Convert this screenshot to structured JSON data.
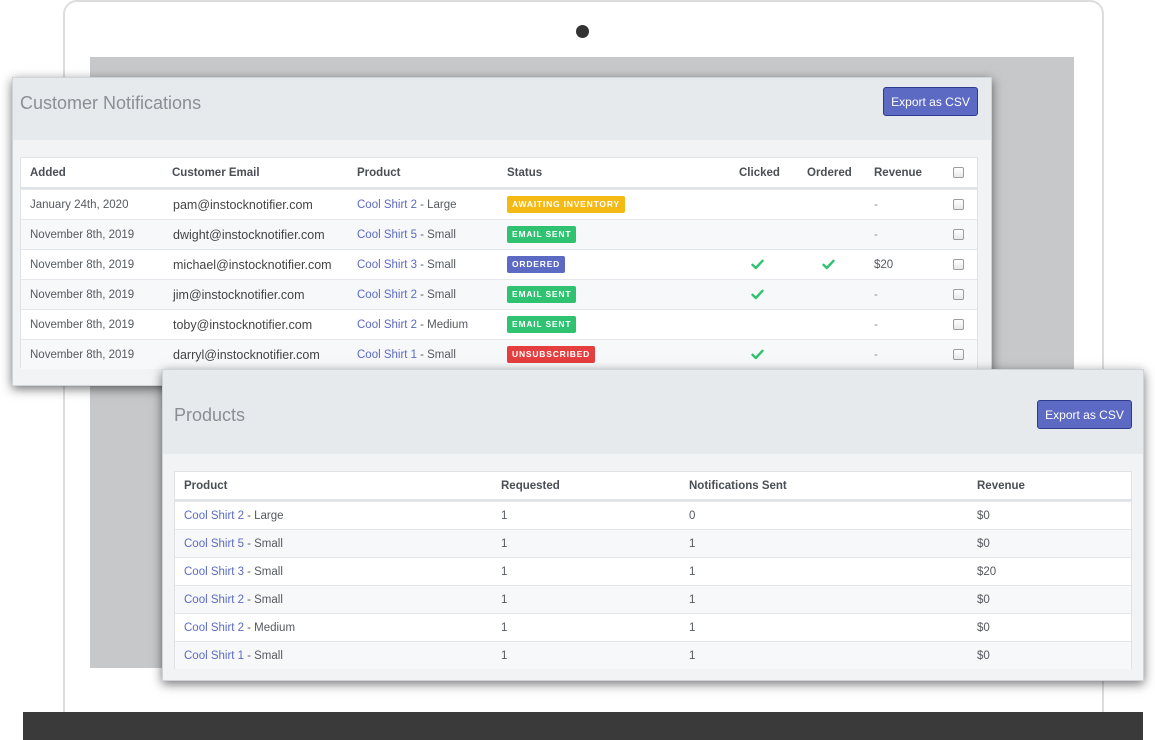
{
  "notifications": {
    "title": "Customer Notifications",
    "export_label": "Export as CSV",
    "columns": [
      "Added",
      "Customer Email",
      "Product",
      "Status",
      "Clicked",
      "Ordered",
      "Revenue"
    ],
    "rows": [
      {
        "added": "January 24th, 2020",
        "email": "pam@instocknotifier.com",
        "product": "Cool Shirt 2",
        "variant": "- Large",
        "status": "AWAITING INVENTORY",
        "status_color": "#f5b915",
        "clicked": false,
        "ordered": false,
        "revenue": "-"
      },
      {
        "added": "November 8th, 2019",
        "email": "dwight@instocknotifier.com",
        "product": "Cool Shirt 5",
        "variant": "- Small",
        "status": "EMAIL SENT",
        "status_color": "#2ec271",
        "clicked": false,
        "ordered": false,
        "revenue": "-"
      },
      {
        "added": "November 8th, 2019",
        "email": "michael@instocknotifier.com",
        "product": "Cool Shirt 3",
        "variant": "- Small",
        "status": "ORDERED",
        "status_color": "#5c6ac4",
        "clicked": true,
        "ordered": true,
        "revenue": "$20"
      },
      {
        "added": "November 8th, 2019",
        "email": "jim@instocknotifier.com",
        "product": "Cool Shirt 2",
        "variant": "- Small",
        "status": "EMAIL SENT",
        "status_color": "#2ec271",
        "clicked": true,
        "ordered": false,
        "revenue": "-"
      },
      {
        "added": "November 8th, 2019",
        "email": "toby@instocknotifier.com",
        "product": "Cool Shirt 2",
        "variant": "- Medium",
        "status": "EMAIL SENT",
        "status_color": "#2ec271",
        "clicked": false,
        "ordered": false,
        "revenue": "-"
      },
      {
        "added": "November 8th, 2019",
        "email": "darryl@instocknotifier.com",
        "product": "Cool Shirt 1",
        "variant": "- Small",
        "status": "UNSUBSCRIBED",
        "status_color": "#e53e3e",
        "clicked": true,
        "ordered": false,
        "revenue": "-"
      }
    ]
  },
  "products": {
    "title": "Products",
    "export_label": "Export as CSV",
    "columns": [
      "Product",
      "Requested",
      "Notifications Sent",
      "Revenue"
    ],
    "rows": [
      {
        "product": "Cool Shirt 2",
        "variant": "- Large",
        "requested": "1",
        "sent": "0",
        "revenue": "$0"
      },
      {
        "product": "Cool Shirt 5",
        "variant": "- Small",
        "requested": "1",
        "sent": "1",
        "revenue": "$0"
      },
      {
        "product": "Cool Shirt 3",
        "variant": "- Small",
        "requested": "1",
        "sent": "1",
        "revenue": "$20"
      },
      {
        "product": "Cool Shirt 2",
        "variant": "- Small",
        "requested": "1",
        "sent": "1",
        "revenue": "$0"
      },
      {
        "product": "Cool Shirt 2",
        "variant": "- Medium",
        "requested": "1",
        "sent": "1",
        "revenue": "$0"
      },
      {
        "product": "Cool Shirt 1",
        "variant": "- Small",
        "requested": "1",
        "sent": "1",
        "revenue": "$0"
      }
    ]
  },
  "icons": {
    "checkmark": "check-icon",
    "camera": "camera-dot"
  }
}
